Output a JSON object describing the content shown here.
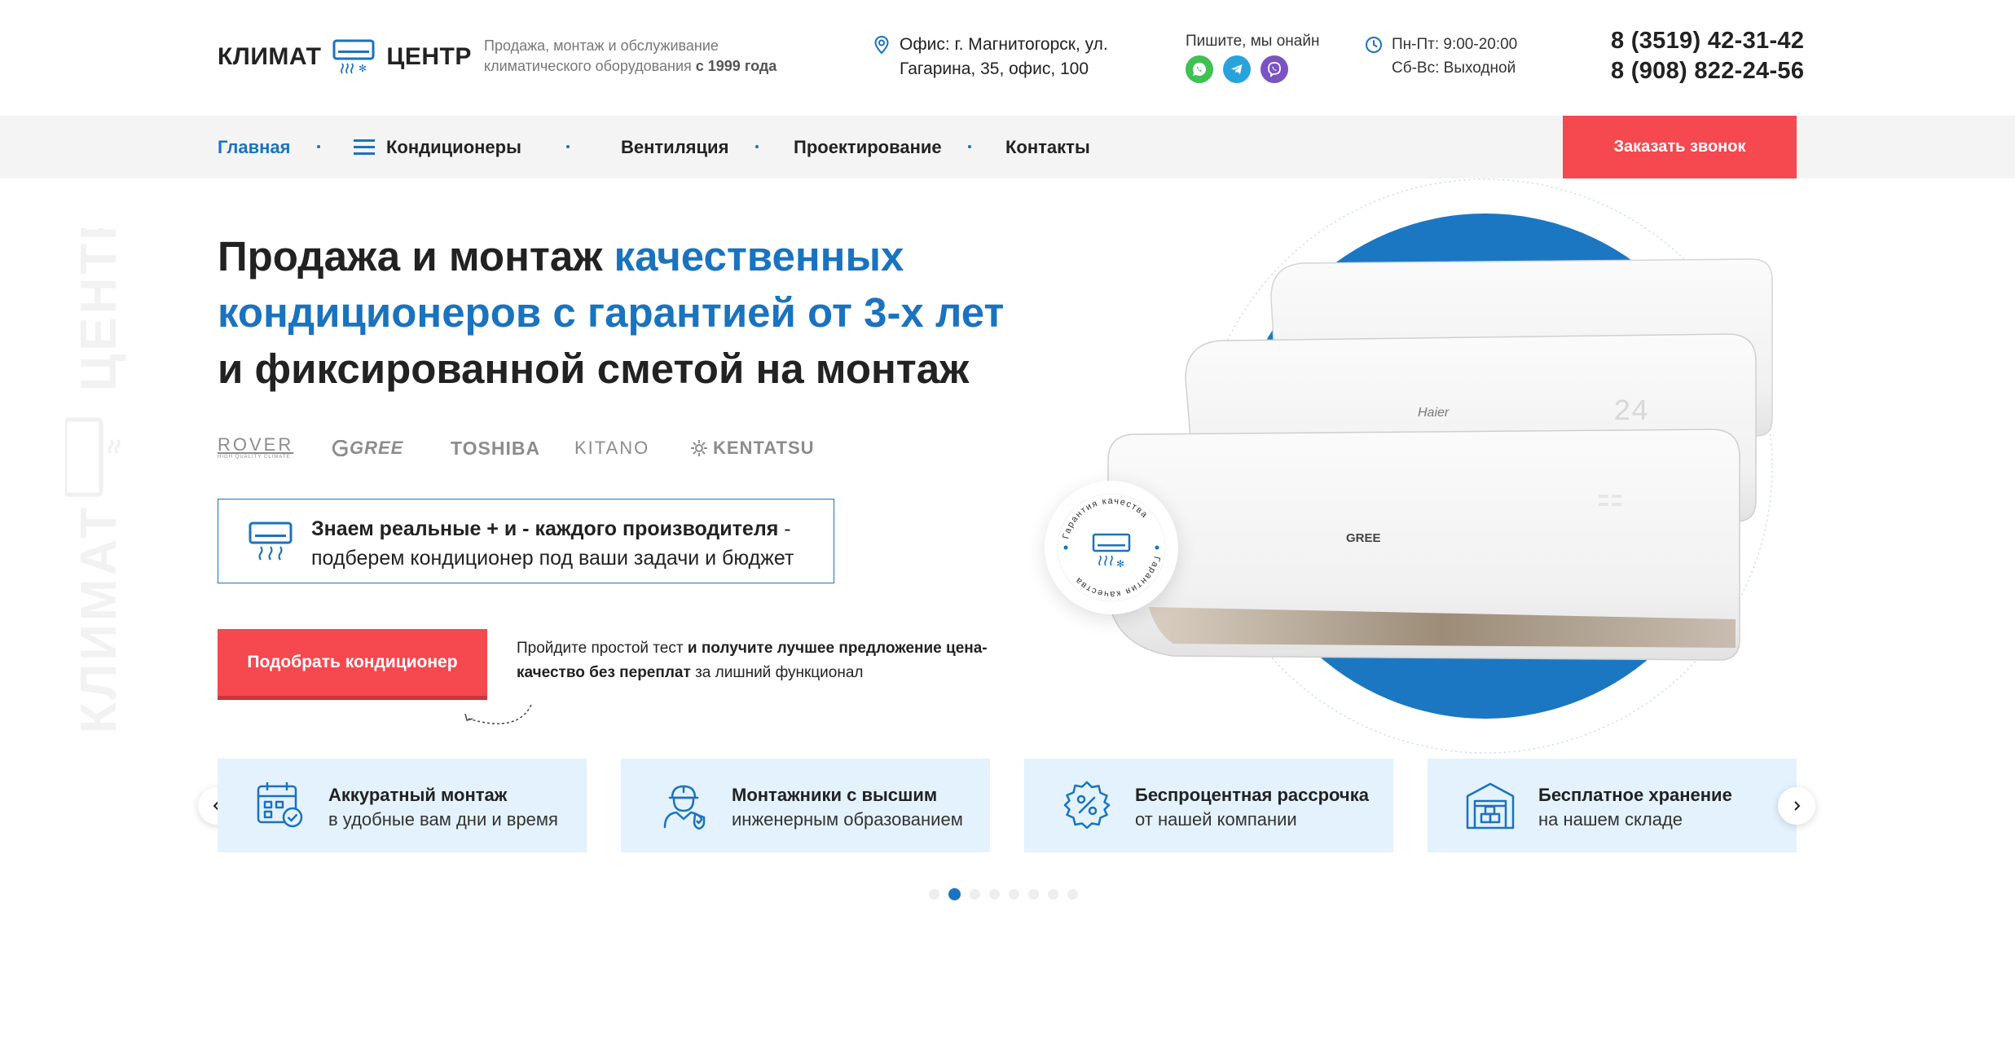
{
  "header": {
    "logo_left": "КЛИМАТ",
    "logo_right": "ЦЕНТР",
    "tagline_line1": "Продажа, монтаж и обслуживание",
    "tagline_line2": "климатического оборудования ",
    "tagline_bold": "с 1999 года",
    "address_line1": "Офис: г. Магнитогорск, ул.",
    "address_line2": "Гагарина, 35, офис, 100",
    "messengers_label": "Пишите, мы онайн",
    "messengers": [
      "whatsapp-icon",
      "telegram-icon",
      "viber-icon"
    ],
    "hours_line1": "Пн-Пт: 9:00-20:00",
    "hours_line2": "Сб-Вс: Выходной",
    "phone1": "8 (3519) 42-31-42",
    "phone2": "8 (908) 822-24-56"
  },
  "nav": {
    "items": [
      {
        "label": "Главная",
        "active": true
      },
      {
        "label": "Кондиционеры",
        "active": false
      },
      {
        "label": "Вентиляция",
        "active": false
      },
      {
        "label": "Проектирование",
        "active": false
      },
      {
        "label": "Контакты",
        "active": false
      }
    ],
    "callback_label": "Заказать звонок"
  },
  "hero": {
    "title_part1": "Продажа и монтаж ",
    "title_accent_1": "качественных",
    "title_accent_2": "кондиционеров с гарантией от 3-х лет",
    "title_part3": "и фиксированной сметой на монтаж",
    "brands": [
      "ROVER",
      "GREE",
      "TOSHIBA",
      "KITANO",
      "KENTATSU"
    ],
    "rover_sub": "HIGH QUALITY CLIMATE",
    "info_bold": "Знаем реальные + и - каждого производителя",
    "info_dash": " -",
    "info_line2": "подберем кондиционер под ваши задачи и бюджет",
    "select_button": "Подобрать кондиционер",
    "test_text_1": "Пройдите простой тест ",
    "test_text_bold": "и получите лучшее предложение цена-качество без переплат",
    "test_text_2": " за лишний функционал",
    "badge_text": "Гарантия качества",
    "unit_brands": [
      "Haier",
      "GREE"
    ],
    "unit_display": "24",
    "vertical_logo_1": "КЛИМАТ",
    "vertical_logo_2": "ЦЕНТР"
  },
  "features": [
    {
      "title": "Аккуратный монтаж",
      "sub": "в удобные вам дни и время",
      "icon": "calendar-icon"
    },
    {
      "title": "Монтажники с высшим",
      "sub": "инженерным образованием",
      "icon": "worker-icon"
    },
    {
      "title": "Беспроцентная рассрочка",
      "sub": "от нашей компании",
      "icon": "percent-badge-icon"
    },
    {
      "title": "Бесплатное хранение",
      "sub": "на нашем складе",
      "icon": "warehouse-icon"
    }
  ],
  "slider": {
    "total_dots": 8,
    "active_dot": 1
  },
  "colors": {
    "accent": "#1a73be",
    "cta": "#f5484f",
    "feature_bg": "#e3f2fd",
    "nav_bg": "#f4f4f4"
  }
}
